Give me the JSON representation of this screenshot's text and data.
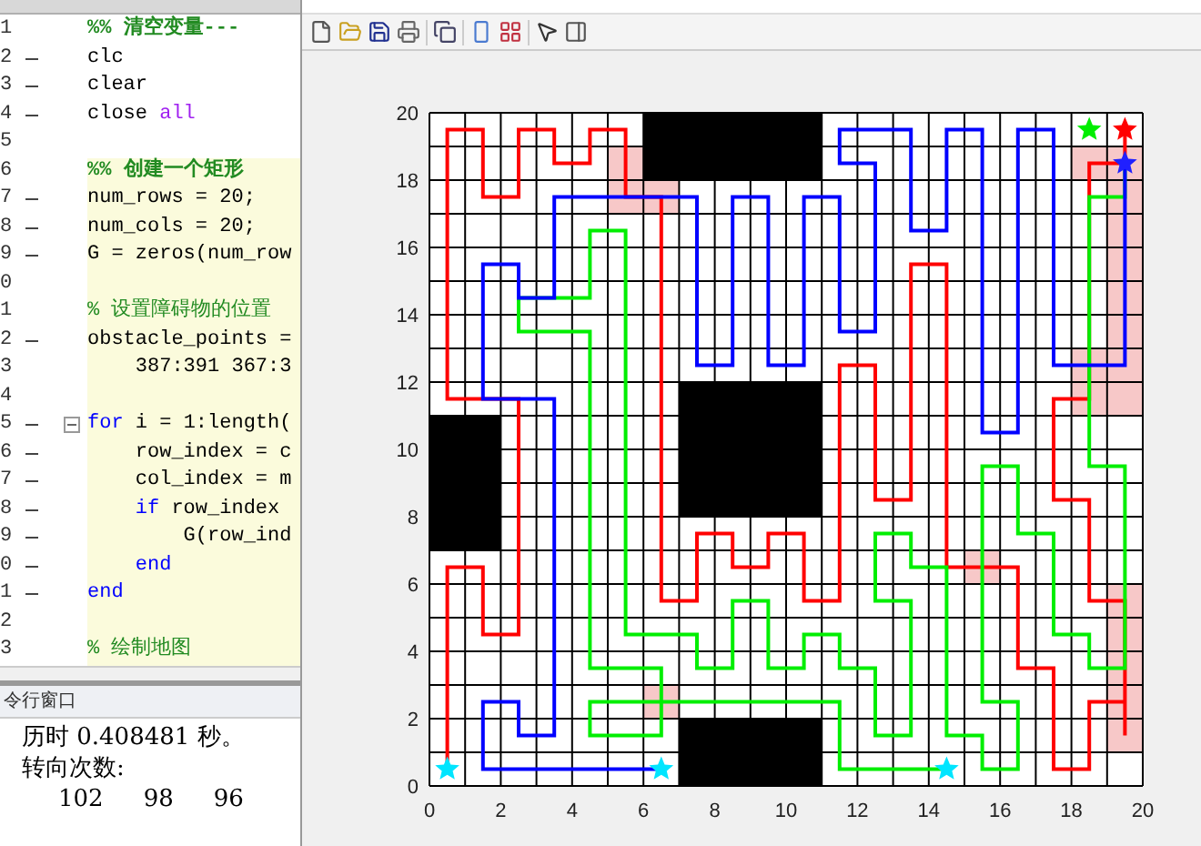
{
  "editor": {
    "lines": [
      {
        "number": "1",
        "executable": false,
        "cell": false,
        "fold": false,
        "segments": [
          {
            "kind": "cell-title",
            "text": "%% 清空变量---"
          }
        ]
      },
      {
        "number": "2",
        "executable": true,
        "cell": false,
        "fold": false,
        "segments": [
          {
            "kind": "plain",
            "text": "clc"
          }
        ]
      },
      {
        "number": "3",
        "executable": true,
        "cell": false,
        "fold": false,
        "segments": [
          {
            "kind": "plain",
            "text": "clear"
          }
        ]
      },
      {
        "number": "4",
        "executable": true,
        "cell": false,
        "fold": false,
        "segments": [
          {
            "kind": "plain",
            "text": "close "
          },
          {
            "kind": "string",
            "text": "all"
          }
        ]
      },
      {
        "number": "5",
        "executable": false,
        "cell": false,
        "fold": false
      },
      {
        "number": "6",
        "executable": false,
        "cell": true,
        "fold": false,
        "segments": [
          {
            "kind": "cell-title",
            "text": "%% 创建一个矩形"
          }
        ]
      },
      {
        "number": "7",
        "executable": true,
        "cell": true,
        "fold": false,
        "segments": [
          {
            "kind": "plain",
            "text": "num_rows = 20;"
          }
        ]
      },
      {
        "number": "8",
        "executable": true,
        "cell": true,
        "fold": false,
        "segments": [
          {
            "kind": "plain",
            "text": "num_cols = 20;"
          }
        ]
      },
      {
        "number": "9",
        "executable": true,
        "cell": true,
        "fold": false,
        "segments": [
          {
            "kind": "plain",
            "text": "G = zeros(num_row"
          }
        ]
      },
      {
        "number": "0",
        "executable": false,
        "cell": true,
        "fold": false
      },
      {
        "number": "1",
        "executable": false,
        "cell": true,
        "fold": false,
        "segments": [
          {
            "kind": "comment",
            "text": "% 设置障碍物的位置"
          }
        ]
      },
      {
        "number": "2",
        "executable": true,
        "cell": true,
        "fold": false,
        "segments": [
          {
            "kind": "plain",
            "text": "obstacle_points ="
          }
        ]
      },
      {
        "number": "3",
        "executable": false,
        "cell": true,
        "fold": false,
        "segments": [
          {
            "kind": "plain",
            "text": "    387:391 367:3"
          }
        ]
      },
      {
        "number": "4",
        "executable": false,
        "cell": true,
        "fold": false
      },
      {
        "number": "5",
        "executable": true,
        "cell": true,
        "fold": true,
        "segments": [
          {
            "kind": "keyword",
            "text": "for"
          },
          {
            "kind": "plain",
            "text": " i = 1:length("
          }
        ]
      },
      {
        "number": "6",
        "executable": true,
        "cell": true,
        "fold": false,
        "segments": [
          {
            "kind": "plain",
            "text": "    row_index = c"
          }
        ]
      },
      {
        "number": "7",
        "executable": true,
        "cell": true,
        "fold": false,
        "segments": [
          {
            "kind": "plain",
            "text": "    col_index = m"
          }
        ]
      },
      {
        "number": "8",
        "executable": true,
        "cell": true,
        "fold": false,
        "segments": [
          {
            "kind": "keyword",
            "text": "    if"
          },
          {
            "kind": "plain",
            "text": " row_index"
          }
        ]
      },
      {
        "number": "9",
        "executable": true,
        "cell": true,
        "fold": false,
        "segments": [
          {
            "kind": "plain",
            "text": "        G(row_ind"
          }
        ]
      },
      {
        "number": "0",
        "executable": true,
        "cell": true,
        "fold": false,
        "segments": [
          {
            "kind": "keyword",
            "text": "    end"
          }
        ]
      },
      {
        "number": "1",
        "executable": true,
        "cell": true,
        "fold": false,
        "segments": [
          {
            "kind": "keyword",
            "text": "end"
          }
        ]
      },
      {
        "number": "2",
        "executable": false,
        "cell": true,
        "fold": false
      },
      {
        "number": "3",
        "executable": false,
        "cell": true,
        "fold": false,
        "segments": [
          {
            "kind": "comment",
            "text": "% 绘制地图"
          }
        ]
      }
    ]
  },
  "command_window": {
    "title": "令行窗口",
    "lines": [
      "历时 0.408481 秒。",
      "转向次数:"
    ],
    "values": [
      "102",
      "98",
      "96"
    ]
  },
  "figure": {
    "yticks": [
      "20",
      "18",
      "16",
      "14",
      "12",
      "10",
      "8",
      "6",
      "4",
      "2",
      "0"
    ],
    "xticks": [
      "0",
      "2",
      "4",
      "6",
      "8",
      "10",
      "12",
      "14",
      "16",
      "18",
      "20"
    ]
  }
}
